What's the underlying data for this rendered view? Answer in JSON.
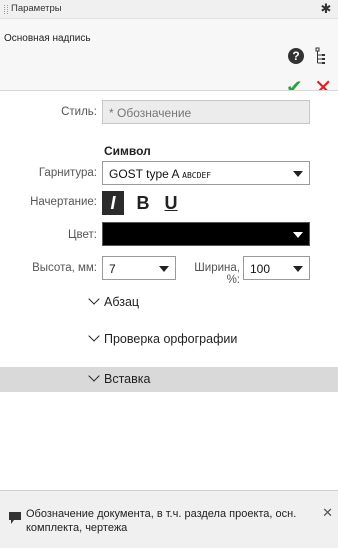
{
  "panel": {
    "title": "Параметры",
    "header_title": "Основная надпись"
  },
  "form": {
    "style_label": "Стиль:",
    "style_value": "* Обозначение",
    "symbol_section": "Символ",
    "font_label": "Гарнитура:",
    "font_value": "GOST type A",
    "font_preview": "ABCDEF",
    "typeface_label": "Начертание:",
    "italic_label": "I",
    "bold_label": "B",
    "underline_label": "U",
    "color_label": "Цвет:",
    "color_value": "#000000",
    "height_label": "Высота, мм:",
    "height_value": "7",
    "width_label": "Ширина, %:",
    "width_value": "100"
  },
  "sections": {
    "paragraph": "Абзац",
    "spellcheck": "Проверка орфографии",
    "insert": "Вставка"
  },
  "hint": {
    "text": "Обозначение документа, в т.ч. раздела проекта, осн. комплекта, чертежа"
  },
  "icons": {
    "pin": "pin-icon",
    "help": "help-icon",
    "tree": "tree-icon",
    "ok": "checkmark-icon",
    "cancel": "close-icon"
  },
  "colors": {
    "ok": "#2aa33c",
    "cancel": "#e02020",
    "band": "#d9d9d9"
  }
}
